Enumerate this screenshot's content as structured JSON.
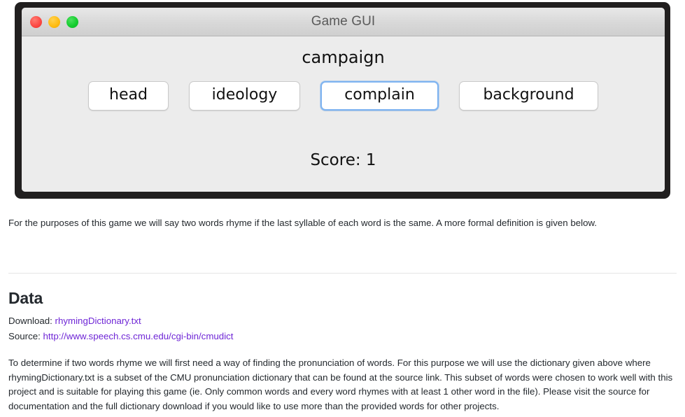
{
  "window": {
    "title": "Game GUI",
    "controls": [
      {
        "name": "close",
        "color": "#fc4a45"
      },
      {
        "name": "minimize",
        "color": "#ffbd14"
      },
      {
        "name": "maximize",
        "color": "#15cd2f"
      }
    ],
    "prompt_word": "campaign",
    "choices": [
      {
        "label": "head",
        "focused": false
      },
      {
        "label": "ideology",
        "focused": false
      },
      {
        "label": "complain",
        "focused": true
      },
      {
        "label": "background",
        "focused": false
      }
    ],
    "score_label": "Score: 1",
    "focus_ring_color": "#7eb3f0"
  },
  "page": {
    "intro": "For the purposes of this game we will say two words rhyme if the last syllable of each word is the same. A more formal definition is given below.",
    "section_heading": "Data",
    "download_label": "Download:",
    "download_link": "rhymingDictionary.txt",
    "source_label": "Source:",
    "source_link": "http://www.speech.cs.cmu.edu/cgi-bin/cmudict",
    "link_color": "#6f26d6",
    "body": "To determine if two words rhyme we will first need a way of finding the pronunciation of words. For this purpose we will use the dictionary given above where rhymingDictionary.txt is a subset of the CMU pronunciation dictionary that can be found at the source link. This subset of words were chosen to work well with this project and is suitable for playing this game (ie. Only common words and every word rhymes with at least 1 other word in the file). Please visit the source for documentation and the full dictionary download if you would like to use more than the provided words for other projects."
  }
}
